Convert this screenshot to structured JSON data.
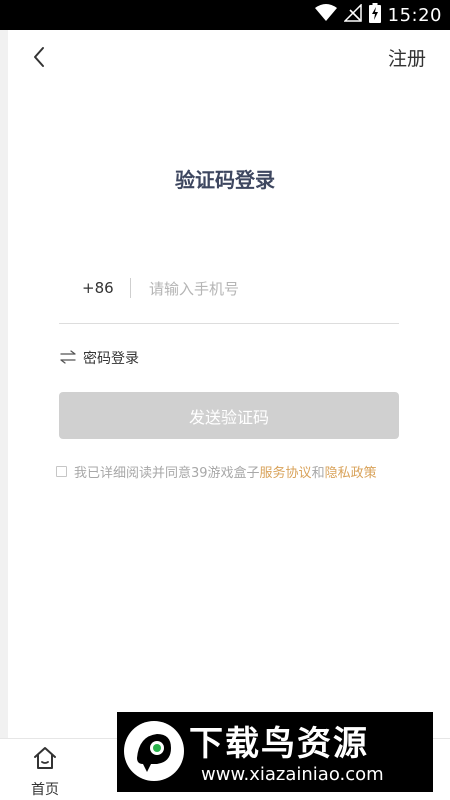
{
  "status_bar": {
    "time": "15:20",
    "icons": [
      "wifi-icon",
      "no-signal-icon",
      "battery-charging-icon"
    ]
  },
  "nav": {
    "back_icon": "chevron-left-icon",
    "register_label": "注册"
  },
  "title": "验证码登录",
  "phone": {
    "country_code": "+86",
    "placeholder": "请输入手机号",
    "value": ""
  },
  "password_login": {
    "icon": "swap-arrows-icon",
    "label": "密码登录"
  },
  "send_button": {
    "label": "发送验证码",
    "enabled": false,
    "color": "#d0d0d0"
  },
  "agreement": {
    "checked": false,
    "prefix": "我已详细阅读并同意39游戏盒子",
    "service_link": "服务协议",
    "conjunction": "和",
    "privacy_link": "隐私政策",
    "link_color": "#d9a35b"
  },
  "bottom_nav": {
    "home_label": "首页",
    "home_icon": "home-icon"
  },
  "watermark": {
    "title": "下载鸟资源",
    "url": "www.xiazainiao.com"
  },
  "colors": {
    "title": "#3e4760",
    "placeholder": "#b5b5b5"
  }
}
